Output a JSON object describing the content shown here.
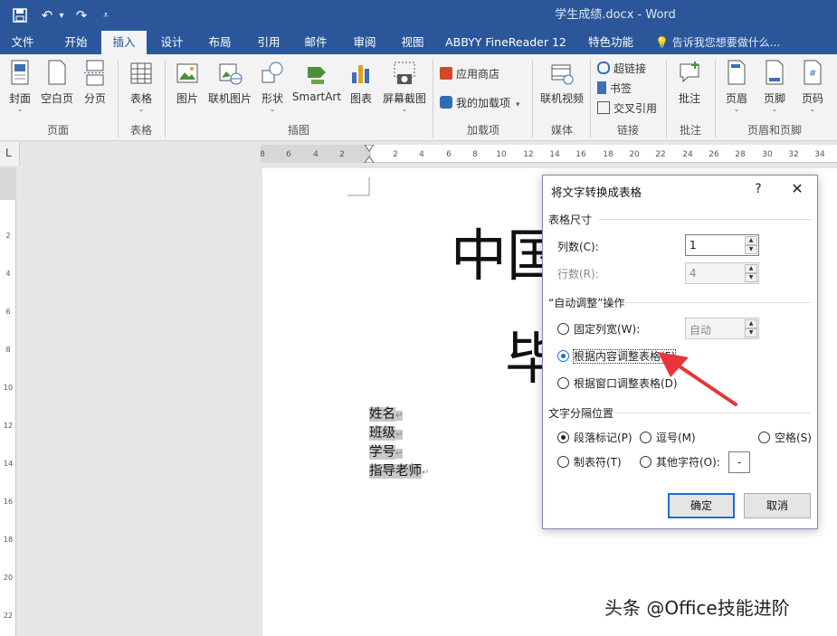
{
  "window": {
    "title": "学生成绩.docx - Word",
    "qat": {
      "save_icon": "save-icon",
      "undo": "↶",
      "undo_dropdown": "▾",
      "redo": "↷",
      "customize": "⩡"
    }
  },
  "tabs": [
    {
      "label": "文件"
    },
    {
      "label": "开始"
    },
    {
      "label": "插入"
    },
    {
      "label": "设计"
    },
    {
      "label": "布局"
    },
    {
      "label": "引用"
    },
    {
      "label": "邮件"
    },
    {
      "label": "审阅"
    },
    {
      "label": "视图"
    },
    {
      "label": "ABBYY FineReader 12"
    },
    {
      "label": "特色功能"
    }
  ],
  "active_tab": "插入",
  "tell_me": "告诉我您想要做什么...",
  "ribbon": {
    "buttons": {
      "cover": "封面",
      "blank": "空白页",
      "break": "分页",
      "table": "表格",
      "picture": "图片",
      "online_picture": "联机图片",
      "shapes": "形状",
      "smartart": "SmartArt",
      "chart": "图表",
      "screenshot": "屏幕截图",
      "store": "应用商店",
      "my_addins": "我的加载项",
      "online_video": "联机视频",
      "hyperlink": "超链接",
      "bookmark": "书签",
      "cross_ref": "交叉引用",
      "comment": "批注",
      "header": "页眉",
      "footer": "页脚",
      "page_number": "页码"
    },
    "groups": {
      "pages": "页面",
      "tables": "表格",
      "illustrations": "插图",
      "addins": "加载项",
      "media": "媒体",
      "links": "链接",
      "comments": "批注",
      "header_footer": "页眉和页脚"
    },
    "dropdown": "⌄"
  },
  "ruler": {
    "corner": "L",
    "h_ticks": [
      "8",
      "6",
      "4",
      "2",
      "2",
      "4",
      "6",
      "8",
      "10",
      "12",
      "14",
      "16",
      "18",
      "20",
      "22",
      "24",
      "26",
      "28",
      "30",
      "32",
      "34"
    ],
    "v_ticks": [
      "2",
      "4",
      "6",
      "8",
      "10",
      "12",
      "14",
      "16",
      "18",
      "20",
      "22"
    ]
  },
  "document": {
    "heading_line1": "中国",
    "heading_line2": "毕",
    "selected_lines": [
      "姓名",
      "班级",
      "学号",
      "指导老师"
    ],
    "para_mark": "↵"
  },
  "dialog": {
    "title": "将文字转换成表格",
    "help": "?",
    "close": "✕",
    "table_size": {
      "section": "表格尺寸",
      "cols_label": "列数(C):",
      "cols_value": "1",
      "rows_label": "行数(R):",
      "rows_value": "4"
    },
    "autofit": {
      "section": "“自动调整”操作",
      "fixed_label": "固定列宽(W):",
      "fixed_value": "自动",
      "by_content": "根据内容调整表格(F)",
      "by_window": "根据窗口调整表格(D)",
      "selected": "根据内容调整表格(F)"
    },
    "separator": {
      "section": "文字分隔位置",
      "paragraph": "段落标记(P)",
      "comma": "逗号(M)",
      "space": "空格(S)",
      "tab": "制表符(T)",
      "other": "其他字符(O):",
      "other_value": "-",
      "selected": "段落标记(P)"
    },
    "ok": "确定",
    "cancel": "取消"
  },
  "annotation_color": "#e8343a",
  "watermark": "头条 @Office技能进阶",
  "colors": {
    "brand": "#2b579a",
    "ribbon": "#f3f3f3",
    "focus_blue": "#1a6fd1"
  }
}
